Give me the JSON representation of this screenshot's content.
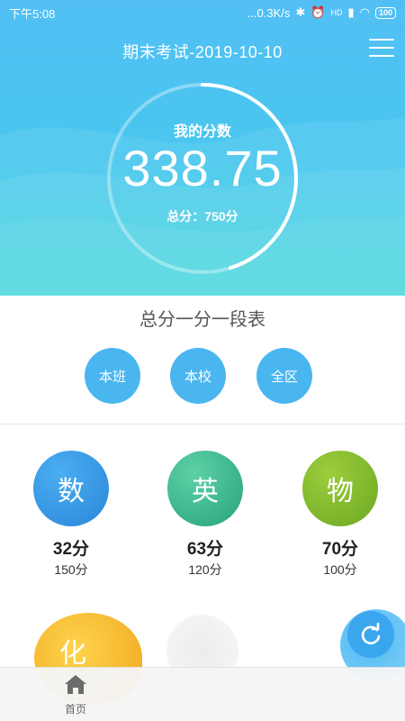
{
  "status_bar": {
    "time": "下午5:08",
    "network_speed": "...0.3K/s",
    "network_type": "HD",
    "battery": "100"
  },
  "header": {
    "title": "期末考试-2019-10-10",
    "menu_icon": "hamburger-menu-icon"
  },
  "score": {
    "label": "我的分数",
    "value": "338.75",
    "total_label": "总分：750分",
    "progress_fraction": 0.4517
  },
  "section": {
    "title": "总分一分一段表",
    "buttons": [
      "本班",
      "本校",
      "全区"
    ]
  },
  "subjects": [
    {
      "name": "数",
      "score": "32分",
      "full": "150分",
      "color": "#2b86d8"
    },
    {
      "name": "英",
      "score": "63分",
      "full": "120分",
      "color": "#27a37b"
    },
    {
      "name": "物",
      "score": "70分",
      "full": "100分",
      "color": "#6ca822"
    }
  ],
  "partial_subjects": [
    {
      "name": "化",
      "color": "#f0a81f"
    }
  ],
  "bottom_nav": {
    "home_label": "首页",
    "home_icon": "home-icon"
  },
  "colors": {
    "accent": "#4ab6f0",
    "hero_top": "#52bff4",
    "hero_bottom": "#3dd6da"
  }
}
